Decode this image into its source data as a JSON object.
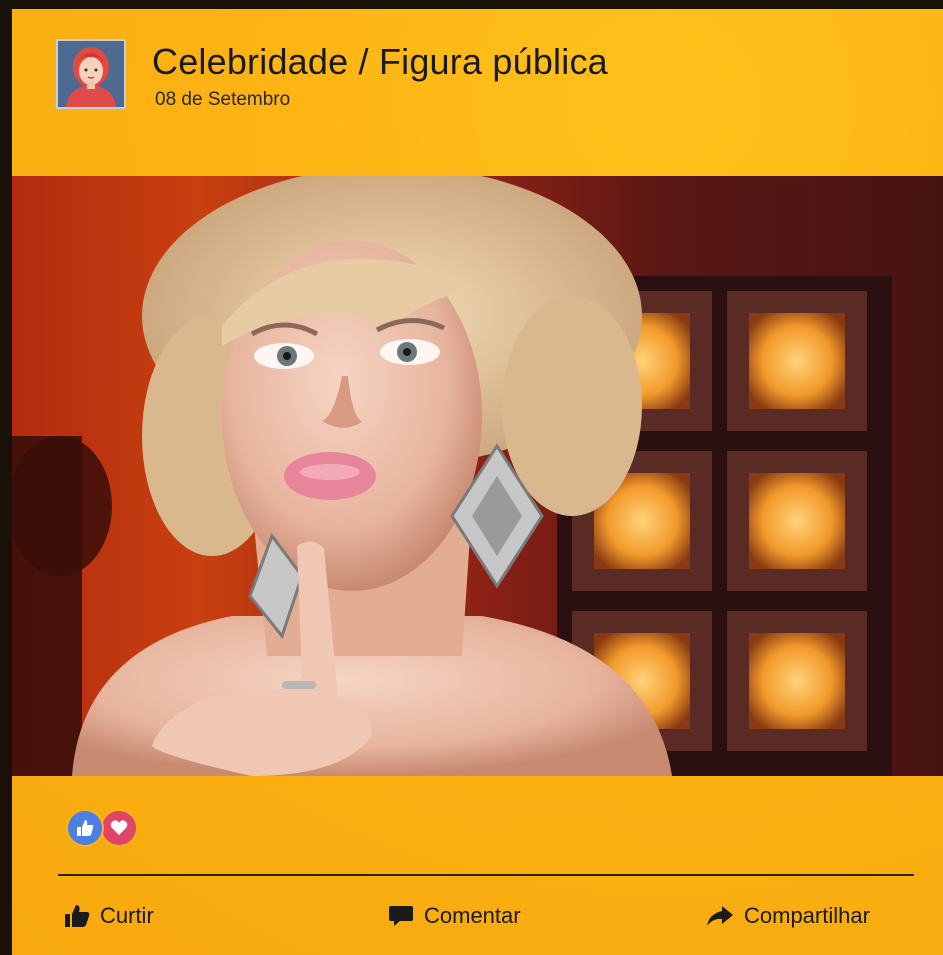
{
  "post": {
    "author": "Celebridade / Figura pública",
    "date": "08 de Setembro",
    "avatar_icon": "woman-avatar-icon"
  },
  "reactions": {
    "icons": [
      "like-reaction-icon",
      "love-reaction-icon"
    ],
    "colors": {
      "like": "#4c7ee6",
      "love": "#e04468"
    }
  },
  "actions": {
    "like_label": "Curtir",
    "comment_label": "Comentar",
    "share_label": "Compartilhar"
  },
  "theme": {
    "background": "#fdb313",
    "text": "#1a1a1a"
  }
}
